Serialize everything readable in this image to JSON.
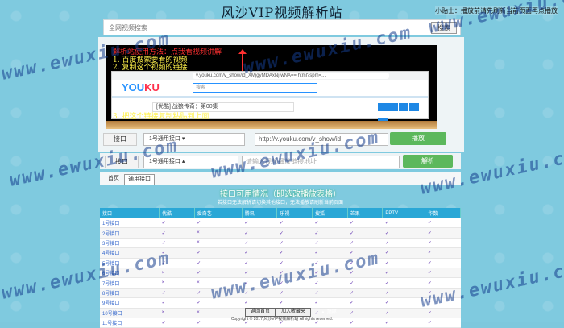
{
  "page": {
    "title": "风沙VIP视频解析站",
    "top_note": "小贴士：播放前请先刷新当前页面再点播放"
  },
  "search": {
    "placeholder": "全网视频搜索",
    "button": "搜索"
  },
  "video": {
    "instructions": [
      "解析站使用方法：点我看视频讲解",
      "1. 百度搜索要看的视频",
      "2. 复制这个视频的链接",
      "3. 把这个链接复制粘贴到上面"
    ],
    "browser_url": "v.youku.com/v_show/id_XMjgyMDAxNjIwNA==.html?spm=...",
    "brand_main": "YOU",
    "brand_accent": "KU",
    "search_hint": "搜索",
    "result_line": "[优酷] 战狼传奇：第00集"
  },
  "player": {
    "line_label": "接口",
    "line_select": "1号通用接口 ▾",
    "url_value": "http://v.youku.com/v_show/id",
    "play_button": "播放"
  },
  "player2": {
    "line_label": "接口",
    "line_select": "1号通用接口 ▴",
    "url_placeholder": "请输入视频播放链接地址",
    "play_button": "解析"
  },
  "tabs": {
    "home": "首页",
    "current": "通用接口"
  },
  "table": {
    "heading": "接口可用情况（即选改播放表格）",
    "sub": "若接口无法解析请切换其他接口，无法播放请刷新当前页面",
    "headers": [
      "接口",
      "优酷",
      "爱奇艺",
      "腾讯",
      "乐视",
      "搜狐",
      "芒果",
      "PPTV",
      "华数"
    ],
    "rows": [
      [
        "1号接口",
        "✓",
        "✓",
        "✓",
        "✓",
        "✓",
        "✓",
        "✓",
        "✓"
      ],
      [
        "2号接口",
        "✓",
        "×",
        "✓",
        "✓",
        "✓",
        "✓",
        "✓",
        "✓"
      ],
      [
        "3号接口",
        "✓",
        "×",
        "✓",
        "✓",
        "✓",
        "✓",
        "✓",
        "✓"
      ],
      [
        "4号接口",
        "✓",
        "✓",
        "✓",
        "✓",
        "✓",
        "✓",
        "✓",
        "✓"
      ],
      [
        "5号接口",
        "✓",
        "✓",
        "✓",
        "✓",
        "✓",
        "✓",
        "✓",
        "✓"
      ],
      [
        "6号接口",
        "×",
        "✓",
        "✓",
        "✓",
        "✓",
        "✓",
        "✓",
        "✓"
      ],
      [
        "7号接口",
        "×",
        "×",
        "✓",
        "✓",
        "✓",
        "✓",
        "✓",
        "✓"
      ],
      [
        "8号接口",
        "✓",
        "✓",
        "✓",
        "✓",
        "✓",
        "✓",
        "✓",
        "✓"
      ],
      [
        "9号接口",
        "✓",
        "✓",
        "✓",
        "✓",
        "✓",
        "✓",
        "✓",
        "✓"
      ],
      [
        "10号接口",
        "×",
        "×",
        "✓",
        "✓",
        "✓",
        "✓",
        "✓",
        "✓"
      ],
      [
        "11号接口",
        "✓",
        "✓",
        "✓",
        "✓",
        "✓",
        "✓",
        "✓",
        "✓"
      ]
    ]
  },
  "footer": {
    "btn1": "返回首页",
    "btn2": "加入收藏夹",
    "note": "▲ 顶部",
    "copyright": "Copyright © 2017 风沙VIP视频解析站 All rights reserved."
  },
  "watermark": "www.ewuxiu.com"
}
